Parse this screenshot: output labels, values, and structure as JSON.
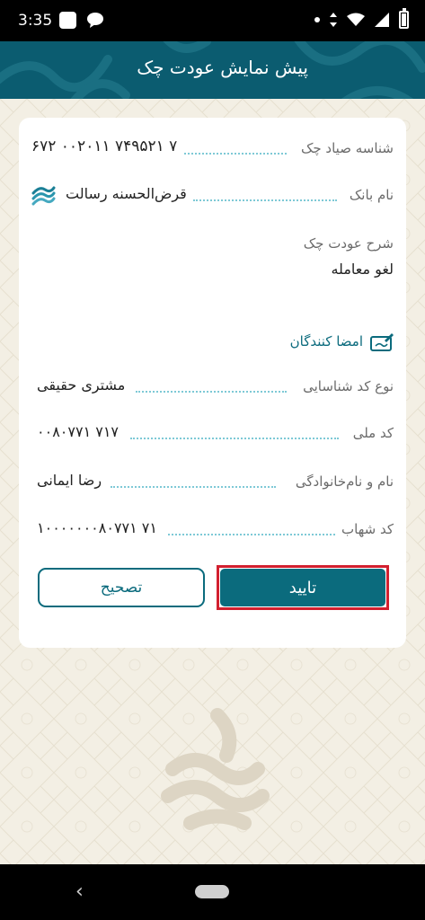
{
  "status_bar": {
    "time": "3:35"
  },
  "header": {
    "title": "پیش نمایش عودت چک"
  },
  "check_info": {
    "sayad_id_label": "شناسه صیاد چک",
    "sayad_id_value": "۶۷۲ ۰۰۲۰۱۱ ۷۴۹۵۲۱ ۷",
    "bank_label": "نام بانک",
    "bank_value": "قرض‌الحسنه رسالت",
    "description_label": "شرح عودت چک",
    "description_value": "لغو معامله"
  },
  "signers": {
    "title": "امضا کنندگان",
    "id_type_label": "نوع کد شناسایی",
    "id_type_value": "مشتری حقیقی",
    "national_code_label": "کد ملی",
    "national_code_value": "۰۰۸۰۷۷۱ ۷۱۷",
    "name_label": "نام و نام‌خانوادگی",
    "name_value": "رضا ایمانی",
    "shahab_label": "کد شهاب",
    "shahab_value": "۱۰۰۰۰۰۰۰۸۰۷۷۱ ۷۱"
  },
  "buttons": {
    "confirm": "تایید",
    "correct": "تصحیح"
  },
  "colors": {
    "primary": "#0b6b7d",
    "header_bg": "#0b5c70",
    "highlight": "#d2202f",
    "page_bg": "#f3efe4"
  }
}
